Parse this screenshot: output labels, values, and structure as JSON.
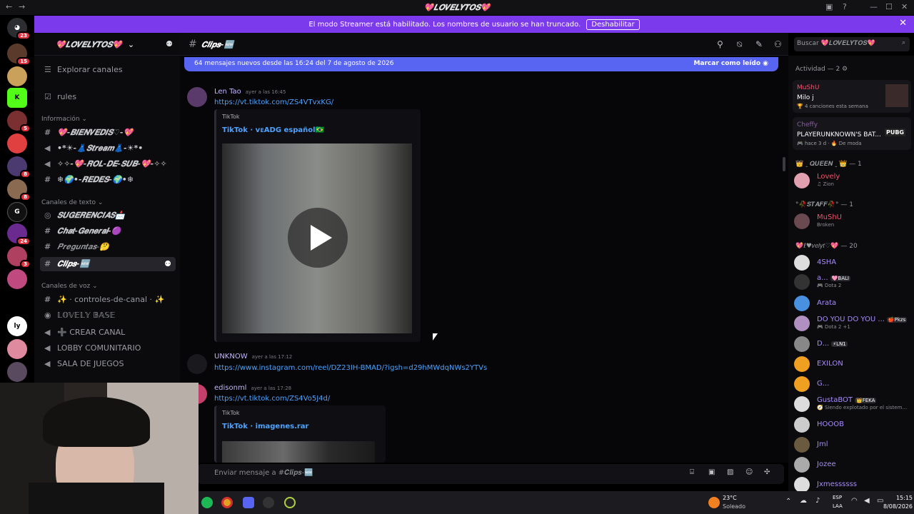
{
  "window": {
    "title": "💖𝑳𝑶𝑽𝑬𝑳𝒀𝑻𝑶𝑺💖"
  },
  "banner": {
    "text": "El modo Streamer está habilitado. Los nombres de usuario se han truncado.",
    "button": "Deshabilitar"
  },
  "guilds": {
    "home_badge": "23",
    "badges": [
      "15",
      "5",
      "8",
      "8",
      "24",
      "3"
    ]
  },
  "server": {
    "name": "💖𝑳𝑶𝑽𝑬𝑳𝒀𝑻𝑶𝑺💖"
  },
  "sidebar": {
    "top_items": [
      {
        "label": "Explorar canales"
      },
      {
        "label": "rules"
      }
    ],
    "cat_info": "Información ⌄",
    "info_channels": [
      "💖-𝑩𝑰𝑬𝑵𝑽𝑬𝑫𝑰𝑺♡-💖",
      "•*☀-👗𝑺𝒕𝒓𝒆𝒂𝒎👗-☀*•",
      "✧✧-💖-𝑹𝑶𝑳-𝑫𝑬-𝑺𝑼𝑩-💖-✧✧",
      "❄🌍•-𝑹𝑬𝑫𝑬𝑺-🌍•❄"
    ],
    "cat_text": "Canales de texto ⌄",
    "text_channels": [
      "𝑺𝑼𝑮𝑬𝑹𝑬𝑵𝑪𝑰𝑨𝑺📩",
      "𝑪𝒉𝒂𝒕-𝑮𝒆𝒏𝒆𝒓𝒂𝒍-🟣",
      "𝑷𝒓𝒆𝒈𝒖𝒏𝒕𝒂𝒔-🤔",
      "𝑪𝒍𝒊𝒑𝒔-🆕"
    ],
    "cat_voice": "Canales de voz ⌄",
    "voice_channels": [
      "✨ · controles-de-canal · ✨",
      "𝕃𝕆𝕍𝔼𝕃𝕐 𝔹𝔸𝕊𝔼",
      "➕ CREAR CANAL",
      "LOBBY COMUNITARIO",
      "SALA DE JUEGOS"
    ]
  },
  "channel": {
    "name": "𝑪𝒍𝒊𝒑𝒔-🆕"
  },
  "search": {
    "placeholder": "Buscar 💖𝑳𝑶𝑽𝑬𝑳𝒀𝑻𝑶𝑺💖"
  },
  "newbar": {
    "text": "64 mensajes nuevos desde las 16:24 del 7 de agosto de 2026",
    "mark": "Marcar como leído"
  },
  "messages": [
    {
      "author": "Len Tao",
      "time": "ayer a las 16:45",
      "link": "https://vt.tiktok.com/ZS4VTvxKG/",
      "provider": "TikTok",
      "title": "TikTok · ᴠᴇADG español🇧🇷"
    },
    {
      "author": "UNKNOW",
      "time": "ayer a las 17:12",
      "link": "https://www.instagram.com/reel/DZ23IH-BMAD/?igsh=d29hMWdqNWs2YTVs"
    },
    {
      "author": "edisonml",
      "time": "ayer a las 17:28",
      "link": "https://vt.tiktok.com/ZS4Vo5J4d/",
      "provider": "TikTok",
      "title": "TikTok · imagenes.rar"
    }
  ],
  "composer": {
    "placeholder": "Enviar mensaje a #𝑪𝒍𝒊𝒑𝒔-🆕"
  },
  "members": {
    "activity_header": "Actividad — 2 ⚙",
    "activities": [
      {
        "name": "MuShU",
        "title": "Milo j",
        "sub": "🏆 4 canciones esta semana"
      },
      {
        "name": "Cheffy",
        "title": "PLAYERUNKNOWN'S BAT...",
        "sub": "🎮 hace 3 d · 🔥 De moda",
        "badge": "PUBG"
      }
    ],
    "groups": [
      {
        "header": "👑 ꞈ 𝑸𝑼𝑬𝑬𝑵 ꞈ 👑 — 1",
        "members": [
          {
            "name": "Lovely",
            "sub": "♫ Zion"
          }
        ]
      },
      {
        "header": "°🥀𝑺𝑻𝑨𝑭𝑭🥀° — 1",
        "members": [
          {
            "name": "MuShU",
            "sub": "Broken"
          }
        ]
      },
      {
        "header": "💖ℓ♥𝑣𝑒𝑙𝑦𝑡♡💖 — 20",
        "members": [
          {
            "name": "4SHA",
            "sub": ""
          },
          {
            "name": "a...",
            "tag": "🩷BALI",
            "sub": "🎮 Dota 2"
          },
          {
            "name": "Arata",
            "sub": ""
          },
          {
            "name": "DO YOU DO YOU ...",
            "tag": "🍎Pkzs",
            "sub": "🎮 Dota 2 +1"
          },
          {
            "name": "D...",
            "tag": "⚡LN1",
            "sub": ""
          },
          {
            "name": "EXILON",
            "sub": ""
          },
          {
            "name": "G...",
            "sub": ""
          },
          {
            "name": "GustaBOT",
            "tag": "👑FEKA",
            "sub": "🧭 Siendo explotado por el sistem..."
          },
          {
            "name": "HOOOB",
            "sub": ""
          },
          {
            "name": "Jml",
            "sub": ""
          },
          {
            "name": "Jozee",
            "sub": ""
          },
          {
            "name": "Jxmessssss",
            "sub": ""
          }
        ]
      }
    ]
  },
  "taskbar": {
    "weather_temp": "23°C",
    "weather_desc": "Soleado",
    "lang1": "ESP",
    "lang2": "LAA",
    "time": "15:15",
    "date": "8/08/2026"
  },
  "colors": {
    "banner": "#7c3aed",
    "newbar": "#5865f2",
    "link": "#4da3ff",
    "member_name": "#a78bfa"
  }
}
